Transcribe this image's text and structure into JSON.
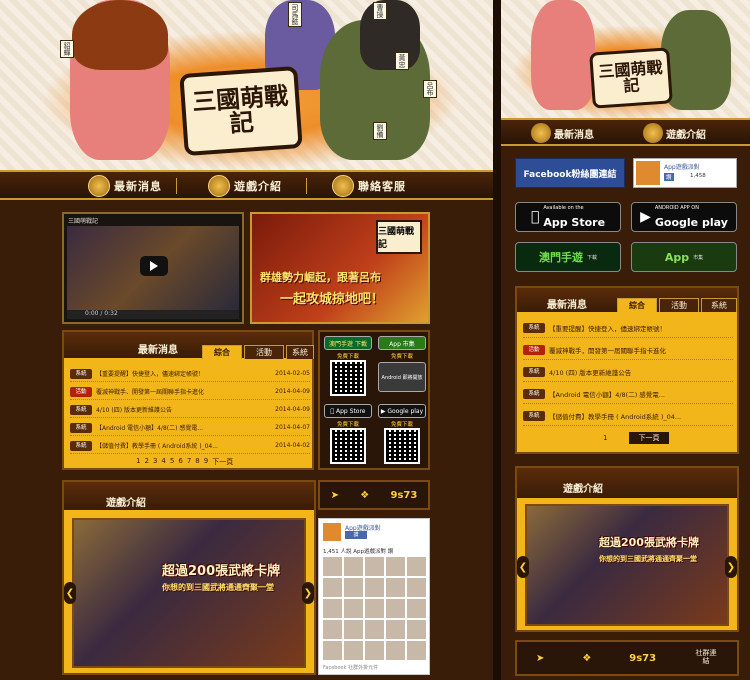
{
  "banner": {
    "logo_text": "三國萌戰記",
    "character_tags": [
      "貂蟬",
      "司馬懿",
      "曹操",
      "黃忠",
      "呂布",
      "劉備"
    ]
  },
  "nav": {
    "items": [
      {
        "label": "最新消息"
      },
      {
        "label": "遊戲介紹"
      },
      {
        "label": "聯絡客服"
      }
    ]
  },
  "video": {
    "title": "三國萌戰記",
    "time": "0:00 / 0:32"
  },
  "promo": {
    "line1": "群雄勢力崛起，跟著呂布",
    "line2": "一起攻城掠地吧！",
    "logo_text": "三國萌戰記"
  },
  "news": {
    "title": "最新消息",
    "tabs": [
      "綜合",
      "活動",
      "系統"
    ],
    "rows": [
      {
        "badge": "系統",
        "text": "【重要提醒】快捷登入，儘速綁定帳號！",
        "date": "2014-02-05"
      },
      {
        "badge": "活動",
        "text": "覆滅神戰手、開發第一屆關聯手指卡進化",
        "date": "2014-04-09"
      },
      {
        "badge": "系統",
        "text": "4/10 (四) 版本更新維護公告",
        "date": "2014-04-09"
      },
      {
        "badge": "系統",
        "text": "【Android 電信小額】4/8(二) 感覺電...",
        "date": "2014-04-07"
      },
      {
        "badge": "系統",
        "text": "【儲值付費】教學手冊 ( Android系統 )_04...",
        "date": "2014-04-02"
      }
    ],
    "pager": [
      "1",
      "2",
      "3",
      "4",
      "5",
      "6",
      "7",
      "8",
      "9",
      "下一頁"
    ]
  },
  "downloads": {
    "left_title": "澳門手遊 下載",
    "right_title": "App 市集",
    "free": "免費下載",
    "app_store": "App Store",
    "google_play": "Google play",
    "android_label": "Android 即將開放"
  },
  "intro": {
    "title": "遊戲介紹",
    "slide_line1": "超過200張武將卡牌",
    "slide_line2": "你想的到三國武將通通齊聚一堂"
  },
  "facebook": {
    "page_name": "App遊戲派對",
    "like_label": "讚",
    "like_count": "1,451 人說 App遊戲派對 讚",
    "footer": "Facebook 社群外掛元件"
  },
  "mobile": {
    "nav": [
      {
        "label": "最新消息"
      },
      {
        "label": "遊戲介紹"
      }
    ],
    "fb_button": "Facebook粉絲團連結",
    "fb_card_name": "App遊戲派對",
    "fb_card_like": "讚",
    "fb_card_count": "1,458",
    "store_app_small": "Available on the",
    "store_app": "App Store",
    "store_google_small": "ANDROID APP ON",
    "store_google": "Google play",
    "store_macau": "澳門手遊",
    "store_macau_small": "下載",
    "store_app_market": "App",
    "store_app_market_small": "市集",
    "news": {
      "title": "最新消息",
      "tabs": [
        "綜合",
        "活動",
        "系統"
      ],
      "rows": [
        {
          "badge": "系統",
          "text": "【重要提醒】快捷登入，儘速綁定帳號！"
        },
        {
          "badge": "活動",
          "text": "覆滅神戰手，開發第一屆關聯手指卡進化"
        },
        {
          "badge": "系統",
          "text": "4/10 (四) 版本更新維護公告"
        },
        {
          "badge": "系統",
          "text": "【Android 電信小額】4/8(二) 感覺電..."
        },
        {
          "badge": "系統",
          "text": "【儲值付費】教學手冊 ( Android系統 )_04..."
        }
      ],
      "page": "1",
      "next": "下一頁"
    },
    "intro": {
      "title": "遊戲介紹",
      "slide_line1": "超過200張武將卡牌",
      "slide_line2": "你想的到三國武將通通齊聚一堂"
    },
    "social_tag": "社群連結"
  },
  "social_icons": [
    "bird-icon",
    "knot-icon",
    "9173-logo"
  ],
  "social_9173": "9s73",
  "colors": {
    "page_bg": "#3a1d08",
    "panel_gold": "#f3b61a",
    "header_brown": "#4a2408",
    "trim_gold": "#c99a2e"
  }
}
